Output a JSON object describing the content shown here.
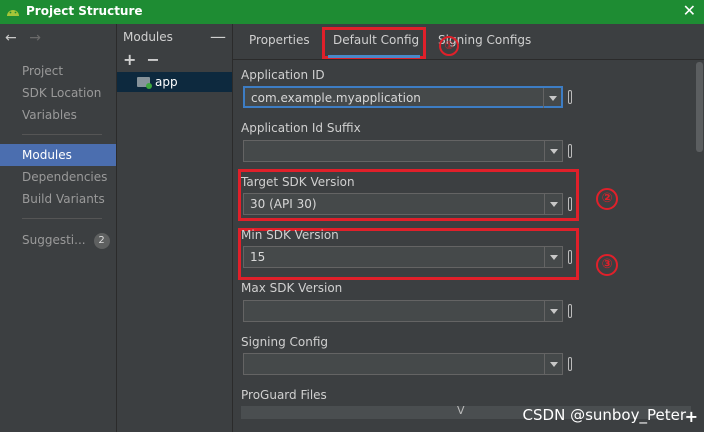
{
  "window": {
    "title": "Project Structure",
    "close_glyph": "✕"
  },
  "nav": {
    "back_glyph": "←",
    "forward_glyph": "→",
    "items": [
      "Project",
      "SDK Location",
      "Variables",
      "Modules",
      "Dependencies",
      "Build Variants"
    ],
    "selected": "Modules",
    "suggestions_label": "Suggesti...",
    "suggestions_count": "2"
  },
  "modules": {
    "header": "Modules",
    "collapse_glyph": "—",
    "add_glyph": "+",
    "remove_glyph": "−",
    "items": [
      "app"
    ]
  },
  "tabs": {
    "items": [
      "Properties",
      "Default Config",
      "Signing Configs"
    ],
    "active": "Default Config"
  },
  "fields": {
    "application_id": {
      "label": "Application ID",
      "value": "com.example.myapplication"
    },
    "application_id_suffix": {
      "label": "Application Id Suffix",
      "value": ""
    },
    "target_sdk": {
      "label": "Target SDK Version",
      "value": "30 (API 30)"
    },
    "min_sdk": {
      "label": "Min SDK Version",
      "value": "15"
    },
    "max_sdk": {
      "label": "Max SDK Version",
      "value": ""
    },
    "signing_config": {
      "label": "Signing Config",
      "value": ""
    },
    "proguard": {
      "label": "ProGuard Files",
      "glyph": "V"
    }
  },
  "annotations": {
    "circle_1": "①",
    "circle_2": "②",
    "circle_3": "③",
    "color": "#e0202a"
  },
  "watermark": "CSDN @sunboy_Peter",
  "bottom_plus": "+"
}
